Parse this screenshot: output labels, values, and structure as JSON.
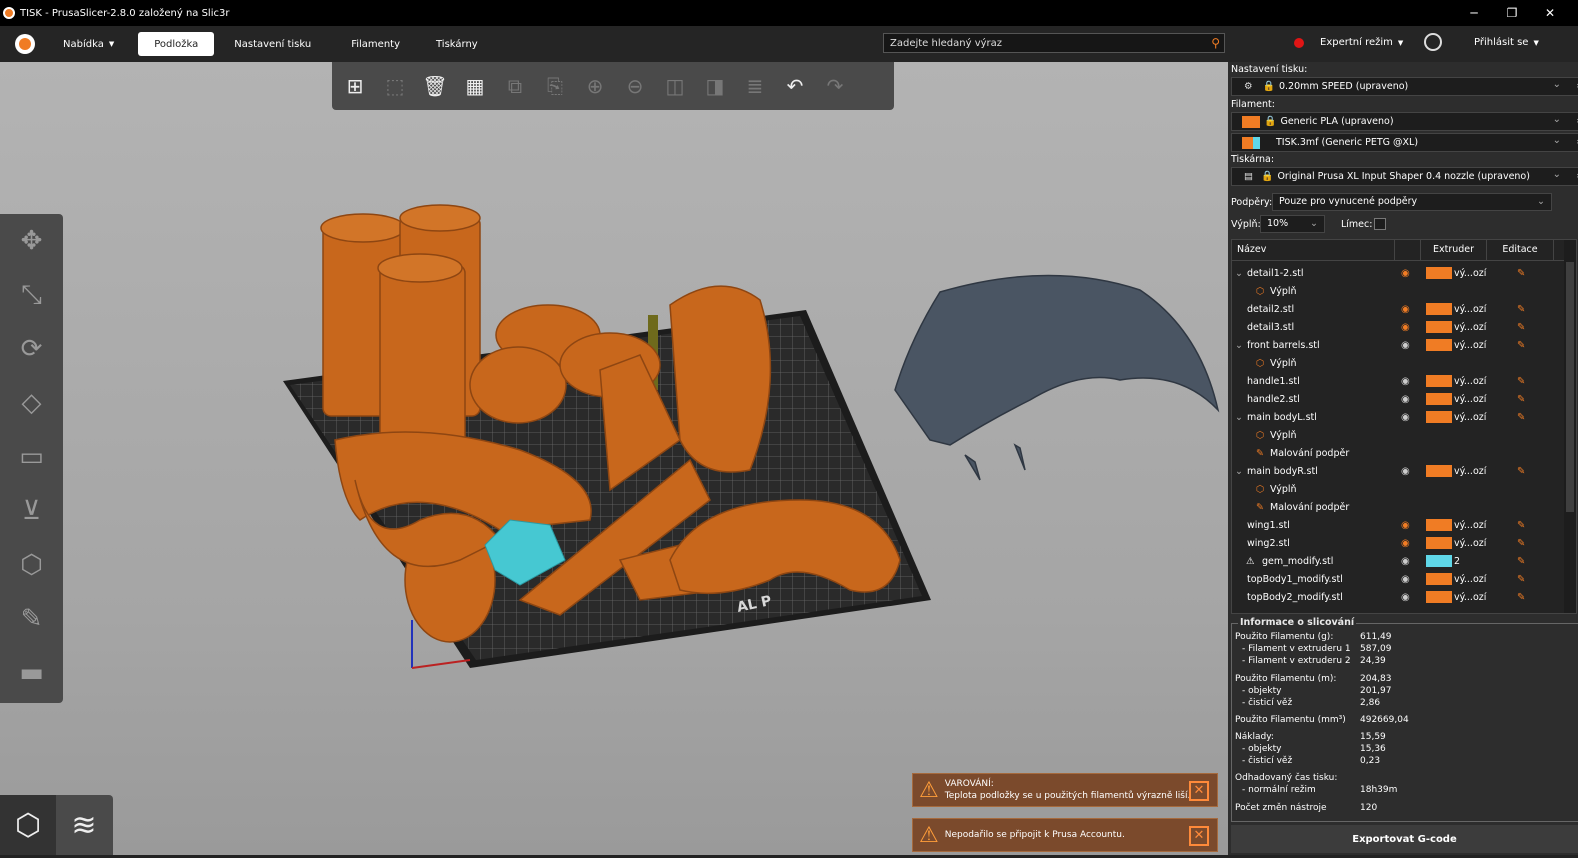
{
  "window": {
    "title": "TISK - PrusaSlicer-2.8.0 založený na Slic3r"
  },
  "topbar": {
    "menu_label": "Nabídka",
    "tabs": [
      {
        "label": "Podložka"
      },
      {
        "label": "Nastavení tisku"
      },
      {
        "label": "Filamenty"
      },
      {
        "label": "Tiskárny"
      }
    ],
    "search_placeholder": "Zadejte hledaný výraz",
    "mode_label": "Expertní režim",
    "login_label": "Přihlásit se"
  },
  "panel": {
    "print_settings_label": "Nastavení tisku:",
    "print_profile": "0.20mm SPEED (upraveno)",
    "filament_label": "Filament:",
    "filaments": [
      {
        "name": "Generic PLA (upraveno)",
        "color": "#f07c24"
      },
      {
        "name": "TISK.3mf (Generic PETG @XL)",
        "color": "#f07c24",
        "color2": "#5fd7e8"
      }
    ],
    "printer_label": "Tiskárna:",
    "printer": "Original Prusa XL Input Shaper 0.4 nozzle (upraveno)",
    "supports_label": "Podpěry:",
    "supports_value": "Pouze pro vynucené podpěry",
    "infill_label": "Výplň:",
    "infill_value": "10%",
    "brim_label": "Límec:",
    "columns": {
      "name": "Název",
      "extruder": "Extruder",
      "edit": "Editace"
    },
    "objects": [
      {
        "name": "detail1-2.stl",
        "expand": "⌄",
        "eye": "strike",
        "extruder": "vý...ozí",
        "color": "#f07c24"
      },
      {
        "name": "Výplň",
        "sub": true,
        "icon": "infill"
      },
      {
        "name": "detail2.stl",
        "eye": "strike",
        "extruder": "vý...ozí",
        "color": "#f07c24"
      },
      {
        "name": "detail3.stl",
        "eye": "strike",
        "extruder": "vý...ozí",
        "color": "#f07c24"
      },
      {
        "name": "front barrels.stl",
        "expand": "⌄",
        "eye": "open",
        "extruder": "vý...ozí",
        "color": "#f07c24"
      },
      {
        "name": "Výplň",
        "sub": true,
        "icon": "infill"
      },
      {
        "name": "handle1.stl",
        "eye": "open",
        "extruder": "vý...ozí",
        "color": "#f07c24"
      },
      {
        "name": "handle2.stl",
        "eye": "open",
        "extruder": "vý...ozí",
        "color": "#f07c24"
      },
      {
        "name": "main bodyL.stl",
        "expand": "⌄",
        "eye": "open",
        "extruder": "vý...ozí",
        "color": "#f07c24"
      },
      {
        "name": "Výplň",
        "sub": true,
        "icon": "infill"
      },
      {
        "name": "Malování podpěr",
        "sub": true,
        "icon": "paint"
      },
      {
        "name": "main bodyR.stl",
        "expand": "⌄",
        "eye": "open",
        "extruder": "vý...ozí",
        "color": "#f07c24"
      },
      {
        "name": "Výplň",
        "sub": true,
        "icon": "infill"
      },
      {
        "name": "Malování podpěr",
        "sub": true,
        "icon": "paint"
      },
      {
        "name": "wing1.stl",
        "eye": "strike",
        "extruder": "vý...ozí",
        "color": "#f07c24"
      },
      {
        "name": "wing2.stl",
        "eye": "strike",
        "extruder": "vý...ozí",
        "color": "#f07c24"
      },
      {
        "name": "gem_modify.stl",
        "warn": true,
        "eye": "open",
        "extruder": "2",
        "color": "#5fd7e8"
      },
      {
        "name": "topBody1_modify.stl",
        "eye": "open",
        "extruder": "vý...ozí",
        "color": "#f07c24"
      },
      {
        "name": "topBody2_modify.stl",
        "eye": "open",
        "extruder": "vý...ozí",
        "color": "#f07c24"
      }
    ],
    "slice_info": {
      "title": "Informace o slicování",
      "rows": [
        {
          "label": "Použito Filamentu (g):",
          "value": "611,49"
        },
        {
          "label": "- Filament v extruderu 1",
          "value": "587,09",
          "indent": true
        },
        {
          "label": "- Filament v extruderu 2",
          "value": "24,39",
          "indent": true
        },
        {
          "label": "Použito Filamentu (m):",
          "value": "204,83"
        },
        {
          "label": "- objekty",
          "value": "201,97",
          "indent": true
        },
        {
          "label": "- čisticí věž",
          "value": "2,86",
          "indent": true
        },
        {
          "label": "Použito Filamentu (mm³)",
          "value": "492669,04"
        },
        {
          "label": "Náklady:",
          "value": "15,59"
        },
        {
          "label": "- objekty",
          "value": "15,36",
          "indent": true
        },
        {
          "label": "- čisticí věž",
          "value": "0,23",
          "indent": true
        },
        {
          "label": "Odhadovaný čas tisku:",
          "value": ""
        },
        {
          "label": "- normální režim",
          "value": "18h39m",
          "indent": true
        },
        {
          "label": "Počet změn nástroje",
          "value": "120"
        }
      ]
    },
    "export_label": "Exportovat G-code"
  },
  "notifications": [
    {
      "title": "VAROVÁNÍ:",
      "text": "Teplota podložky se u použitých filamentů výrazně liší."
    },
    {
      "title": "",
      "text": "Nepodařilo se připojit k Prusa Accountu."
    }
  ],
  "bed_label": "AL P",
  "colors": {
    "accent": "#f07c24",
    "model": "#c8671c",
    "wing": "#4a5563",
    "gem": "#46c8d2"
  }
}
